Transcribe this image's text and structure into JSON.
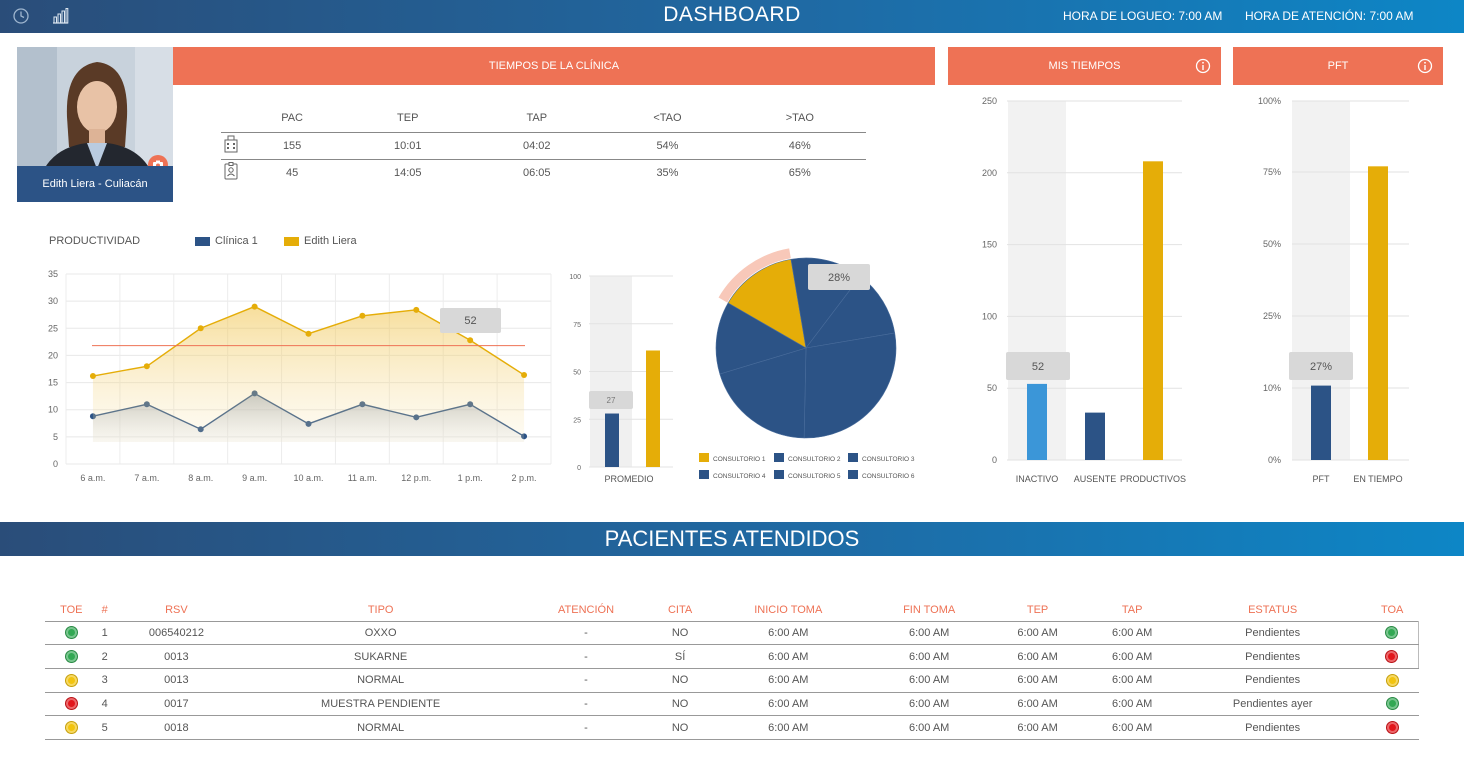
{
  "header": {
    "title": "DASHBOARD",
    "login_time": "HORA DE LOGUEO: 7:00 AM",
    "attention_time": "HORA DE ATENCIÓN: 7:00 AM",
    "icons": [
      "clock-icon",
      "bar-chart-icon"
    ]
  },
  "profile": {
    "name": "Edith Liera - Culiacán"
  },
  "clinic_times": {
    "title": "TIEMPOS DE LA CLÍNICA",
    "columns": [
      "PAC",
      "TEP",
      "TAP",
      "<TAO",
      ">TAO"
    ],
    "rows": [
      {
        "icon": "building-icon",
        "values": [
          "155",
          "10:01",
          "04:02",
          "54%",
          "46%"
        ]
      },
      {
        "icon": "badge-icon",
        "values": [
          "45",
          "14:05",
          "06:05",
          "35%",
          "65%"
        ]
      }
    ]
  },
  "my_times_title": "MIS TIEMPOS",
  "pft_title": "PFT",
  "colors": {
    "accent": "#ee7255",
    "navy": "#2c5386",
    "gold": "#e5ad08",
    "light_blue": "#3b96d8"
  },
  "chart_data": [
    {
      "type": "line",
      "title": "PRODUCTIVIDAD",
      "categories": [
        "6 a.m.",
        "7 a.m.",
        "8 a.m.",
        "9 a.m.",
        "10 a.m.",
        "11 a.m.",
        "12 p.m.",
        "1 p.m.",
        "2 p.m."
      ],
      "ylim": [
        0,
        35
      ],
      "yticks": [
        "0",
        "5",
        "10",
        "15",
        "20",
        "25",
        "30",
        "35"
      ],
      "series": [
        {
          "name": "Clínica 1",
          "values": [
            8.8,
            11,
            6.4,
            13,
            7.4,
            11,
            8.6,
            11,
            5.1
          ]
        },
        {
          "name": "Edith Liera",
          "values": [
            16.2,
            18,
            25,
            29,
            24,
            27.3,
            28.4,
            22.8,
            16.4
          ]
        }
      ],
      "reference_line": 21.8,
      "callout": "52",
      "grid": true
    },
    {
      "type": "bar",
      "categories": [
        "PROMEDIO"
      ],
      "ylim": [
        0,
        100
      ],
      "yticks": [
        "0",
        "25",
        "50",
        "75",
        "100"
      ],
      "series": [
        {
          "values": [
            28
          ]
        },
        {
          "values": [
            61
          ]
        }
      ],
      "callout": "27"
    },
    {
      "type": "pie",
      "labels": [
        "CONSULTORIO 1",
        "CONSULTORIO 2",
        "CONSULTORIO 3",
        "CONSULTORIO 4",
        "CONSULTORIO 5",
        "CONSULTORIO 6"
      ],
      "values": [
        14,
        13,
        12,
        28,
        20,
        13
      ],
      "callout": "28%"
    },
    {
      "type": "bar",
      "title": "MIS TIEMPOS",
      "categories": [
        "INACTIVO",
        "AUSENTE",
        "PRODUCTIVOS"
      ],
      "values": [
        53,
        33,
        208
      ],
      "ylim": [
        0,
        250
      ],
      "yticks": [
        "0",
        "50",
        "100",
        "150",
        "200",
        "250"
      ],
      "callout": "52"
    },
    {
      "type": "bar",
      "title": "PFT",
      "categories": [
        "PFT",
        "EN TIEMPO"
      ],
      "values": [
        10.5,
        77
      ],
      "yticks": [
        "0%",
        "10%",
        "25%",
        "50%",
        "75%",
        "100%"
      ],
      "callout": "27%"
    }
  ],
  "patients": {
    "title": "PACIENTES ATENDIDOS",
    "columns": [
      "TOE",
      "#",
      "RSV",
      "TIPO",
      "ATENCIÓN",
      "CITA",
      "INICIO TOMA",
      "FIN TOMA",
      "TEP",
      "TAP",
      "ESTATUS",
      "TOA"
    ],
    "rows": [
      {
        "toe": "green",
        "num": "1",
        "rsv": "006540212",
        "tipo": "OXXO",
        "atencion": "-",
        "cita": "NO",
        "inicio": "6:00 AM",
        "fin": "6:00 AM",
        "tep": "6:00 AM",
        "tap": "6:00 AM",
        "estatus": "Pendientes",
        "toa": "green"
      },
      {
        "toe": "green",
        "num": "2",
        "rsv": "0013",
        "tipo": "SUKARNE",
        "atencion": "-",
        "cita": "SÍ",
        "inicio": "6:00 AM",
        "fin": "6:00 AM",
        "tep": "6:00 AM",
        "tap": "6:00 AM",
        "estatus": "Pendientes",
        "toa": "red"
      },
      {
        "toe": "yellow",
        "num": "3",
        "rsv": "0013",
        "tipo": "NORMAL",
        "atencion": "-",
        "cita": "NO",
        "inicio": "6:00 AM",
        "fin": "6:00 AM",
        "tep": "6:00 AM",
        "tap": "6:00 AM",
        "estatus": "Pendientes",
        "toa": "yellow"
      },
      {
        "toe": "red",
        "num": "4",
        "rsv": "0017",
        "tipo": "MUESTRA PENDIENTE",
        "atencion": "-",
        "cita": "NO",
        "inicio": "6:00 AM",
        "fin": "6:00 AM",
        "tep": "6:00 AM",
        "tap": "6:00 AM",
        "estatus": "Pendientes ayer",
        "toa": "green"
      },
      {
        "toe": "yellow",
        "num": "5",
        "rsv": "0018",
        "tipo": "NORMAL",
        "atencion": "-",
        "cita": "NO",
        "inicio": "6:00 AM",
        "fin": "6:00 AM",
        "tep": "6:00 AM",
        "tap": "6:00 AM",
        "estatus": "Pendientes",
        "toa": "red"
      }
    ]
  }
}
